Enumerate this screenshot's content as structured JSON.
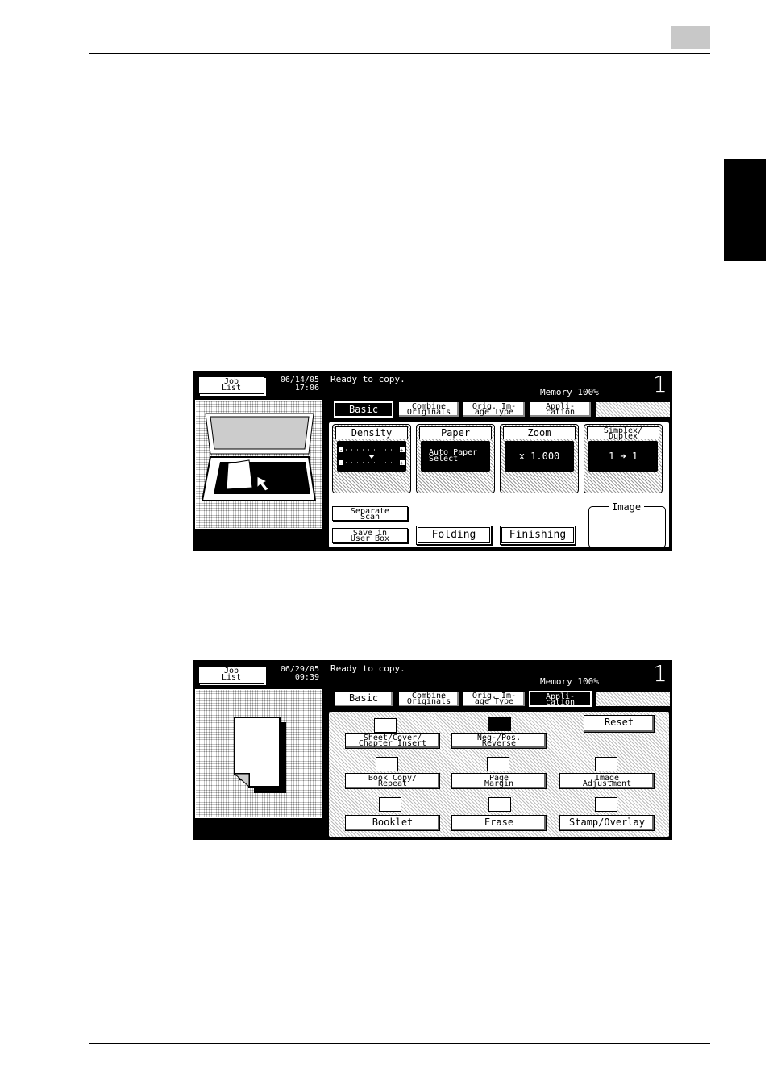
{
  "page": {},
  "panel1": {
    "job_list": [
      "Job",
      "List"
    ],
    "date": "06/14/05",
    "time": "17:06",
    "status": "Ready to copy.",
    "memory": "Memory  100%",
    "counter": "1",
    "tabs": [
      {
        "lines": [
          "Basic"
        ],
        "active": true
      },
      {
        "lines": [
          "Combine",
          "Originals"
        ],
        "active": false
      },
      {
        "lines": [
          "Orig. Im-",
          "age Type"
        ],
        "active": false
      },
      {
        "lines": [
          "Appli-",
          "cation"
        ],
        "active": false
      }
    ],
    "functions": [
      {
        "title": "Density",
        "value": ""
      },
      {
        "title": "Paper",
        "value_lines": [
          "Auto Paper",
          "Select"
        ]
      },
      {
        "title": "Zoom",
        "value": "x 1.000"
      },
      {
        "title_lines": [
          "Simplex/",
          "Duplex"
        ],
        "value": "1 ➜ 1"
      }
    ],
    "separate_scan": [
      "Separate",
      "Scan"
    ],
    "save_user_box": [
      "Save in",
      "User Box"
    ],
    "folding": "Folding",
    "finishing": "Finishing",
    "image_label": "Image"
  },
  "panel2": {
    "job_list": [
      "Job",
      "List"
    ],
    "date": "06/29/05",
    "time": "09:39",
    "status": "Ready to copy.",
    "memory": "Memory  100%",
    "counter": "1",
    "tabs": [
      {
        "lines": [
          "Basic"
        ],
        "active": false
      },
      {
        "lines": [
          "Combine",
          "Originals"
        ],
        "active": false
      },
      {
        "lines": [
          "Orig. Im-",
          "age Type"
        ],
        "active": false
      },
      {
        "lines": [
          "Appli-",
          "cation"
        ],
        "active": true
      }
    ],
    "buttons": {
      "sheet_cover": [
        "Sheet/Cover/",
        "Chapter Insert"
      ],
      "neg_pos": [
        "Neg-/Pos.",
        "Reverse"
      ],
      "reset": "Reset",
      "book_copy": [
        "Book Copy/",
        "Repeat"
      ],
      "page_margin": [
        "Page",
        "Margin"
      ],
      "image_adjustment": [
        "Image",
        "Adjustment"
      ],
      "booklet": "Booklet",
      "erase": "Erase",
      "stamp_overlay": "Stamp/Overlay"
    }
  }
}
